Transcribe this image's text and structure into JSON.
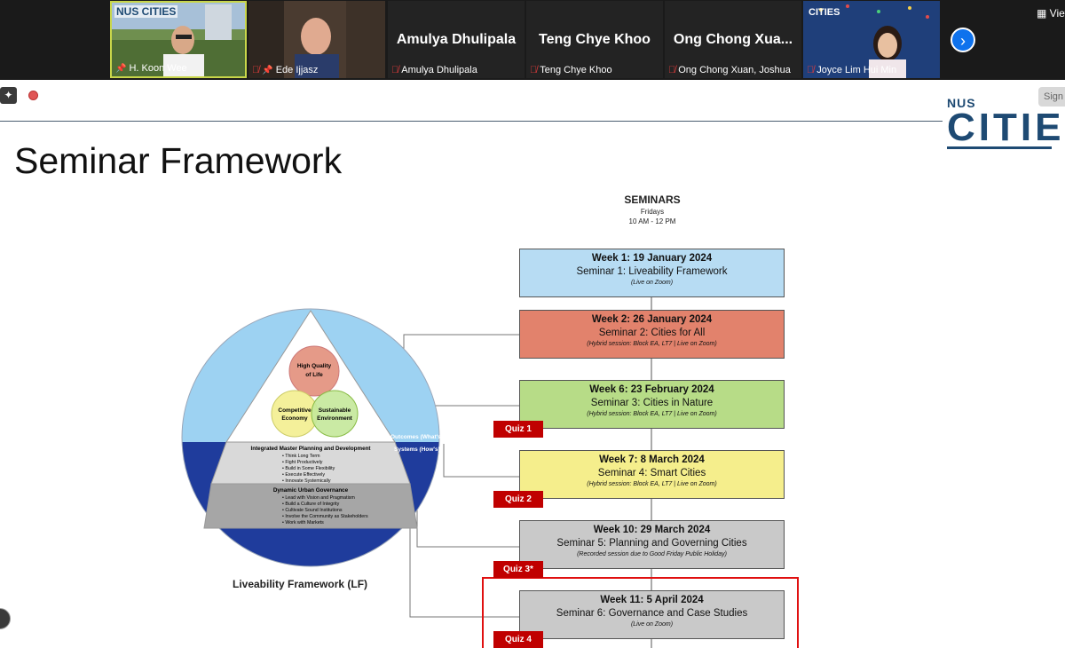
{
  "participants": [
    {
      "name": "H. Koon Wee",
      "big_name": "",
      "muted": false,
      "pinned": true,
      "video": true
    },
    {
      "name": "Ede Ijjasz",
      "big_name": "",
      "muted": true,
      "pinned": true,
      "video": true
    },
    {
      "name": "Amulya Dhulipala",
      "big_name": "Amulya Dhulipala",
      "muted": true,
      "pinned": false,
      "video": false
    },
    {
      "name": "Teng Chye Khoo",
      "big_name": "Teng Chye Khoo",
      "muted": true,
      "pinned": false,
      "video": false
    },
    {
      "name": "Ong Chong Xuan, Joshua",
      "big_name": "Ong Chong Xua...",
      "muted": true,
      "pinned": false,
      "video": false
    },
    {
      "name": "Joyce Lim Hui Min",
      "big_name": "",
      "muted": true,
      "pinned": false,
      "video": true
    }
  ],
  "toolbar": {
    "view_label": "View",
    "signin_label": "Sign"
  },
  "logo": {
    "nus": "NUS",
    "cities": "CITIES",
    "small": "NUS CITIES"
  },
  "slide": {
    "title": "Seminar Framework",
    "seminars_heading": "SEMINARS",
    "seminars_day": "Fridays",
    "seminars_time": "10 AM - 12 PM",
    "weeks": [
      {
        "week": "Week 1: 19 January 2024",
        "seminar": "Seminar 1: Liveability Framework",
        "note": "(Live on Zoom)",
        "color": "#b7dcf3"
      },
      {
        "week": "Week 2: 26 January 2024",
        "seminar": "Seminar 2: Cities for All",
        "note": "(Hybrid session: Block EA, LT7 | Live on Zoom)",
        "color": "#e2826c"
      },
      {
        "week": "Week 6: 23 February 2024",
        "seminar": "Seminar 3: Cities in Nature",
        "note": "(Hybrid session: Block EA, LT7 | Live on Zoom)",
        "color": "#b7dc87"
      },
      {
        "week": "Week 7: 8 March 2024",
        "seminar": "Seminar 4: Smart Cities",
        "note": "(Hybrid session: Block EA, LT7 | Live on Zoom)",
        "color": "#f5ee8c"
      },
      {
        "week": "Week 10: 29 March 2024",
        "seminar": "Seminar 5: Planning and Governing Cities",
        "note": "(Recorded session due to Good Friday Public Holiday)",
        "color": "#c9c9c9"
      },
      {
        "week": "Week 11: 5 April 2024",
        "seminar": "Seminar 6: Governance and Case Studies",
        "note": "(Live on Zoom)",
        "color": "#c9c9c9"
      }
    ],
    "quizzes": [
      "Quiz 1",
      "Quiz 2",
      "Quiz 3*",
      "Quiz 4"
    ],
    "framework": {
      "caption": "Liveability Framework (LF)",
      "top": [
        "High Quality",
        "of Life"
      ],
      "left": [
        "Competitive",
        "Economy"
      ],
      "right": [
        "Sustainable",
        "Environment"
      ],
      "outcomes": "Outcomes (What's)",
      "systems": "Systems (How's)",
      "imp_title": "Integrated Master Planning and Development",
      "imp_items": [
        "Think Long Term",
        "Fight Productively",
        "Build in Some Flexibility",
        "Execute Effectively",
        "Innovate Systemically"
      ],
      "dug_title": "Dynamic Urban Governance",
      "dug_items": [
        "Lead with Vision and Pragmatism",
        "Build a Culture of Integrity",
        "Cultivate Sound Institutions",
        "Involve the Community as Stakeholders",
        "Work with Markets"
      ]
    }
  }
}
